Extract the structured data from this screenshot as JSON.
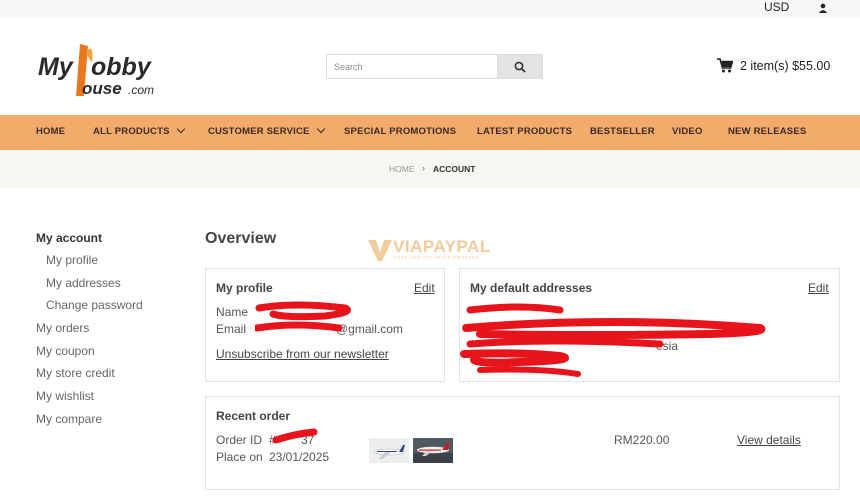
{
  "topbar": {
    "currency": "USD",
    "user_icon": "user-icon"
  },
  "header": {
    "logo_text": "MyHobbyHouse.com",
    "search_placeholder": "Search",
    "cart_summary": "2 item(s) $55.00"
  },
  "nav": {
    "items": [
      {
        "label": "HOME",
        "dropdown": false
      },
      {
        "label": "ALL PRODUCTS",
        "dropdown": true
      },
      {
        "label": "CUSTOMER SERVICE",
        "dropdown": true
      },
      {
        "label": "SPECIAL PROMOTIONS",
        "dropdown": false
      },
      {
        "label": "LATEST PRODUCTS",
        "dropdown": false
      },
      {
        "label": "BESTSELLER",
        "dropdown": false
      },
      {
        "label": "VIDEO",
        "dropdown": false
      },
      {
        "label": "NEW RELEASES",
        "dropdown": false
      }
    ]
  },
  "breadcrumb": {
    "home": "HOME",
    "separator": "›",
    "current": "ACCOUNT"
  },
  "sidebar": {
    "title": "My account",
    "sub_items": [
      "My profile",
      "My addresses",
      "Change password"
    ],
    "items": [
      "My orders",
      "My coupon",
      "My store credit",
      "My wishlist",
      "My compare"
    ]
  },
  "main": {
    "heading": "Overview",
    "watermark": {
      "brand": "VIAPAYPAL",
      "tagline": "FAST AND ACCURATE PROCESS"
    },
    "profile_card": {
      "title": "My profile",
      "edit": "Edit",
      "name_label": "Name",
      "email_label": "Email",
      "email_visible": "@gmail.com",
      "unsubscribe": "Unsubscribe from our newsletter"
    },
    "address_card": {
      "title": "My default addresses",
      "edit": "Edit",
      "address_fragment": "esia"
    },
    "recent_order": {
      "title": "Recent order",
      "order_id_label": "Order ID",
      "order_id_visible": "#",
      "order_id_suffix": "37",
      "place_on_label": "Place on",
      "place_on_value": "23/01/2025",
      "amount": "RM220.00",
      "view_details": "View details"
    }
  },
  "colors": {
    "nav_bg": "#f2ab6a",
    "crumb_bg": "#f7f6f1",
    "redaction": "#e8141c",
    "logo_accent": "#e8781e"
  }
}
